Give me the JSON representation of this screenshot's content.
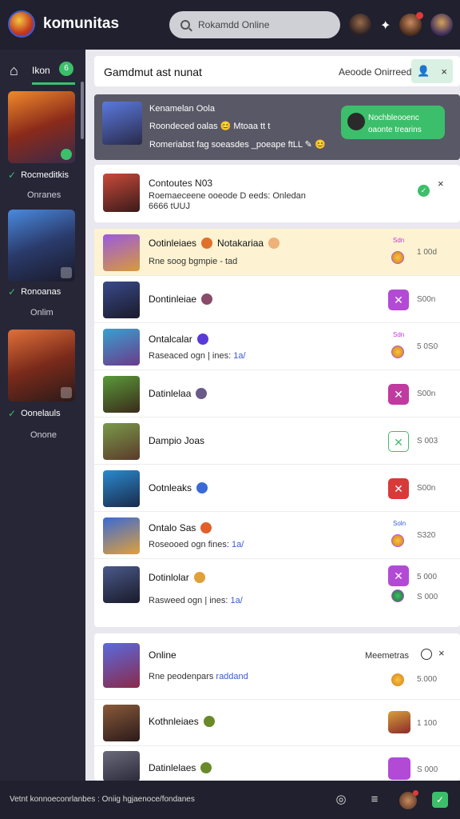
{
  "app": {
    "brand": "komunitas"
  },
  "search": {
    "value": "Rokamdd Online"
  },
  "sidebar": {
    "home_label": "Ikon",
    "home_badge": "6",
    "items": [
      {
        "name": "Rocmeditkis",
        "sub": "Onranes"
      },
      {
        "name": "Ronoanas",
        "sub": "Onlim"
      },
      {
        "name": "Oonelauls",
        "sub": "Onone"
      }
    ]
  },
  "header": {
    "title": "Gamdmut ast nunat",
    "status": "Aeoode Onirreed",
    "close": "×"
  },
  "featured": {
    "title": "Kenamelan Oola",
    "line2": "Roondeced oalas 😊 Mtoaa tt t",
    "line3": "Romeriabst fag soeasdes _poeape ftLL ✎ 😊",
    "button_line1": "Nochbleooenc",
    "button_line2": "oaonte trearins"
  },
  "notification": {
    "title": "Contoutes N03",
    "line2": "Roemaeceene ooeode D eeds: Onledan",
    "line3": "6666 tUUJ",
    "close": "×"
  },
  "list": [
    {
      "name": "Ootinleiaes",
      "extra": "Notakariaa",
      "sub": "Rne soog bgmpie - tad",
      "tiny": "Sdn",
      "value": "1 00d"
    },
    {
      "name": "Dontinleiae",
      "value": "S00n"
    },
    {
      "name": "Ontalcalar",
      "sub": "Raseaced ogn | ines:",
      "sub_hl": "1a/",
      "tiny": "Sdn",
      "value": "5 0S0"
    },
    {
      "name": "Datinlelaa",
      "value": "S00n"
    },
    {
      "name": "Dampio Joas",
      "value": "S 003"
    },
    {
      "name": "Ootnleaks",
      "value": "S00n"
    },
    {
      "name": "Ontalo Sas",
      "sub": "Roseooed ogn fines:",
      "sub_hl": "1a/",
      "tiny": "Soln",
      "value": "S320"
    },
    {
      "name": "Dotinlolar",
      "sub": "Rasweed ogn | ines:",
      "sub_hl": "1a/",
      "value": "5 000",
      "value2": "S 000"
    }
  ],
  "online": {
    "title": "Online",
    "sub": "Rne peodenpars",
    "sub_hl": "raddand",
    "right_label": "Meemetras",
    "close": "×",
    "value": "5.000",
    "rows": [
      {
        "name": "Kothnleiaes",
        "value": "1 100"
      },
      {
        "name": "Datinlelaes",
        "value": "S 000"
      }
    ]
  },
  "bottom": {
    "text": "Vetnt konnoeconrlanbes : Oniig hgjaenoce/fondanes"
  }
}
